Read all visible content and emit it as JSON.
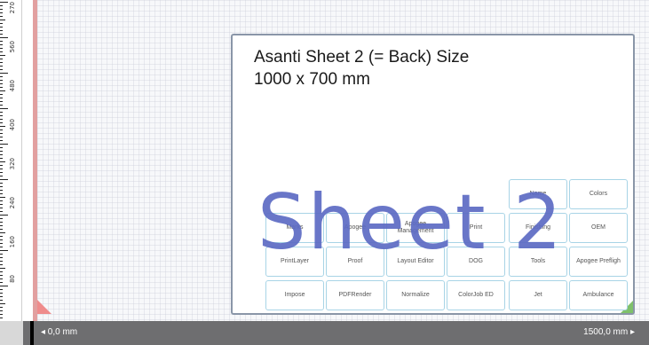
{
  "ruler": {
    "labels": [
      "270",
      "560",
      "480",
      "400",
      "320",
      "240",
      "160",
      "80"
    ]
  },
  "sheet": {
    "title_line1": "Asanti Sheet 2 (= Back) Size",
    "title_line2": "1000 x 700 mm",
    "big_label": "Sheet 2"
  },
  "buttons": {
    "row1": [
      "Name",
      "Colors"
    ],
    "row2": [
      "Marks",
      "Apogee",
      "Apogee Management",
      "Print",
      "Finishing",
      "OEM"
    ],
    "row3": [
      "PrintLayer",
      "Proof",
      "Layout Editor",
      "DOG",
      "Tools",
      "Apogee Prefligh"
    ],
    "row4": [
      "Impose",
      "PDFRender",
      "Normalize",
      "ColorJob ED",
      "Jet",
      "Ambulance"
    ]
  },
  "status": {
    "left": "◂ 0,0 mm",
    "right": "1500,0 mm ▸"
  },
  "colors": {
    "accent_label": "#5d6bc4",
    "status_bg": "#6e6e70",
    "button_border": "#a8d4e6"
  }
}
